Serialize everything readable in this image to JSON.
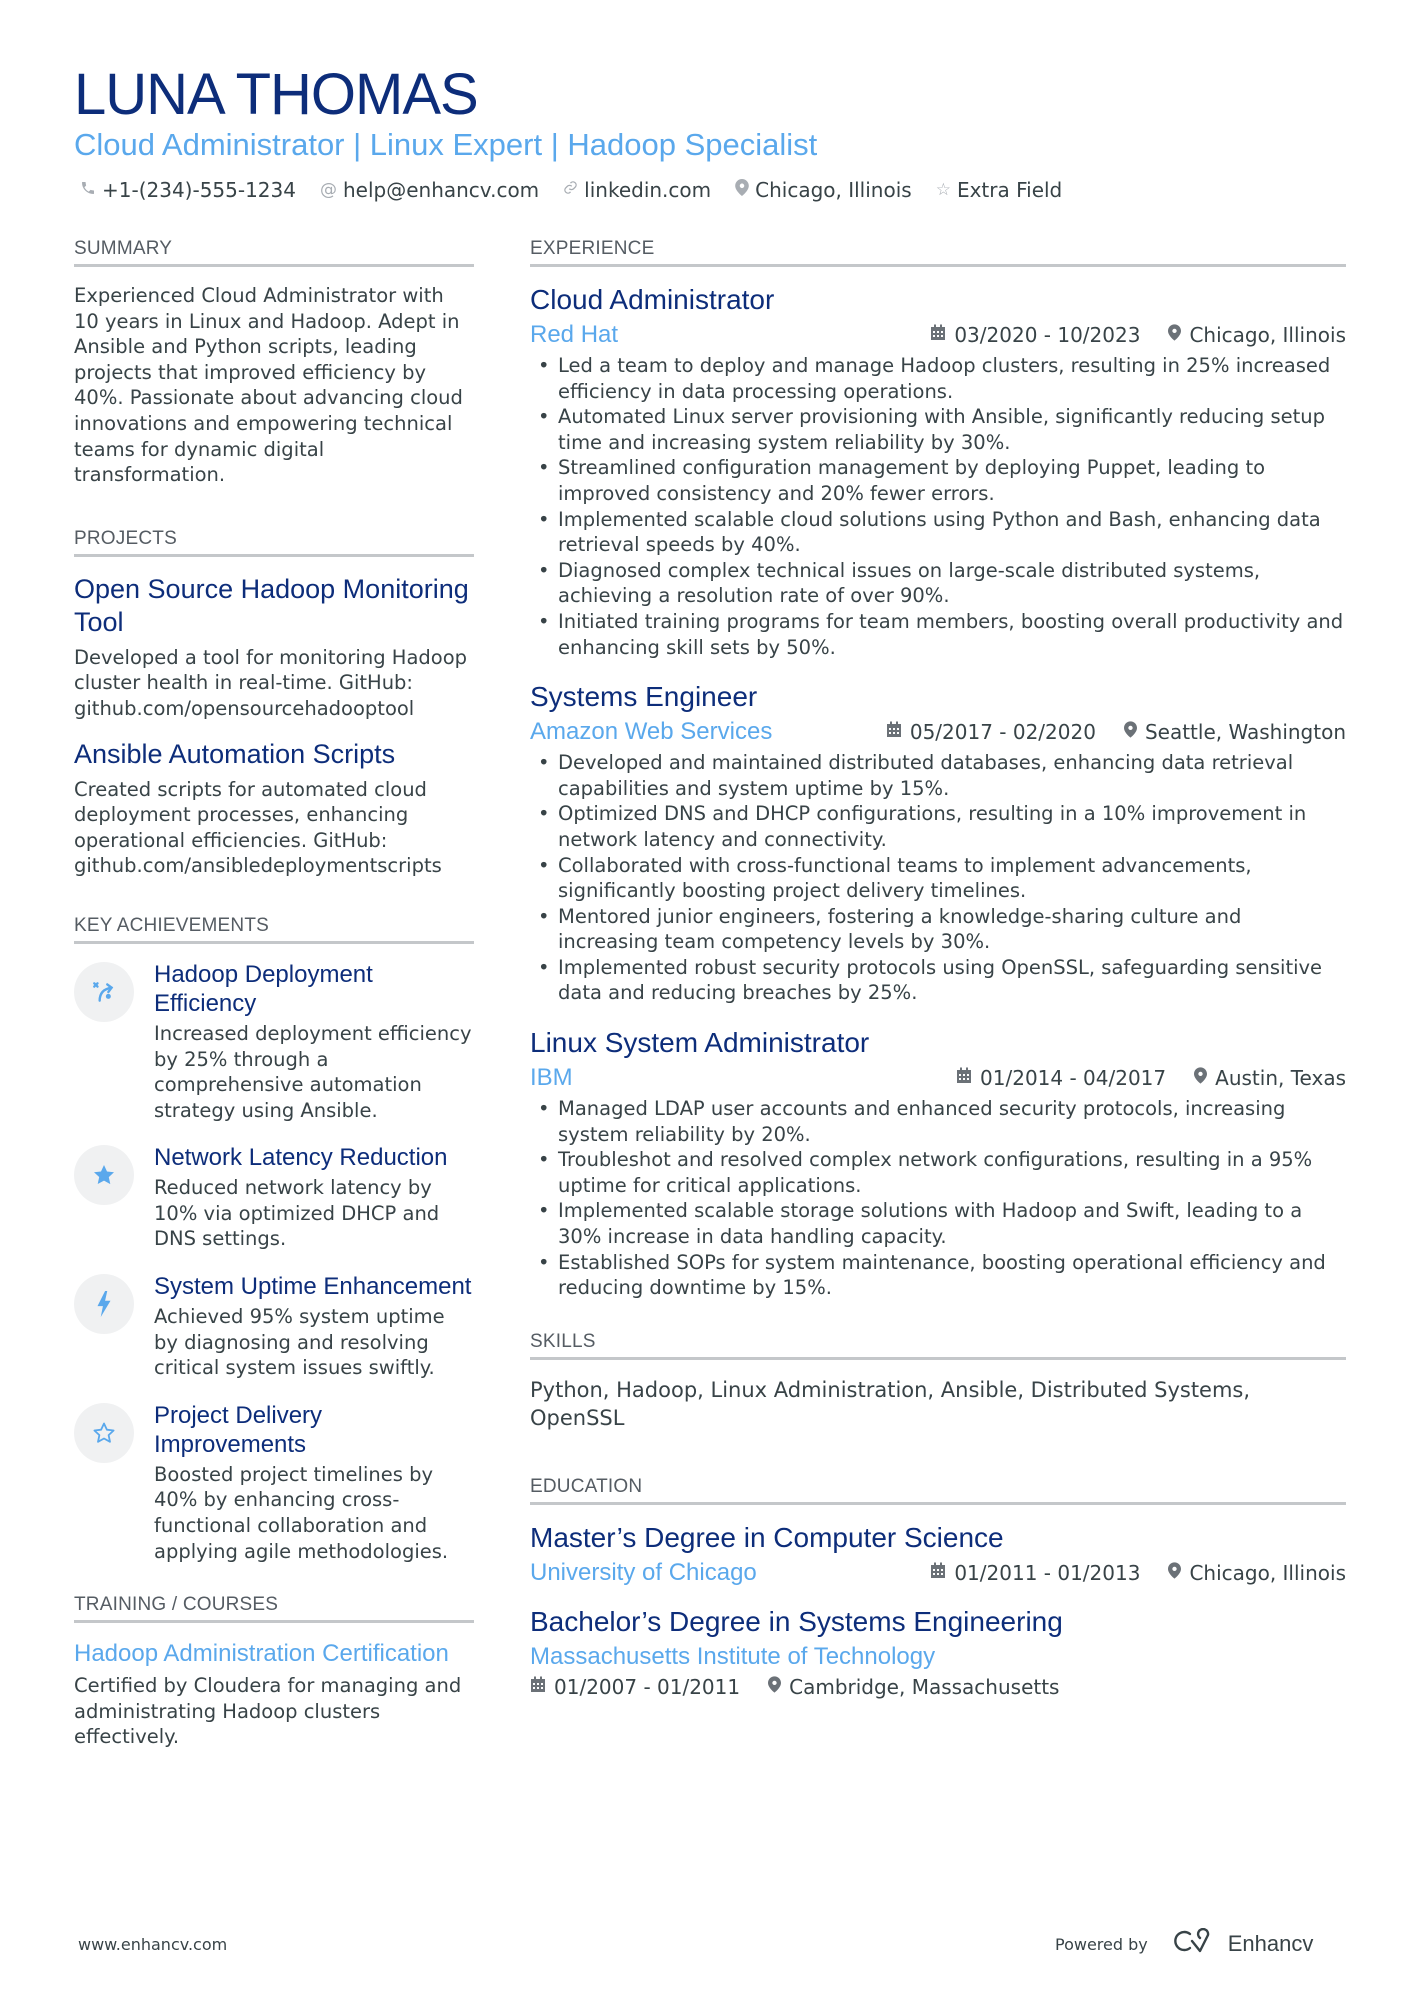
{
  "header": {
    "name": "LUNA THOMAS",
    "headline": "Cloud Administrator | Linux Expert | Hadoop Specialist",
    "contacts": [
      {
        "icon": "phone-icon",
        "glyph": "✆",
        "text": "+1-(234)-555-1234"
      },
      {
        "icon": "at-icon",
        "glyph": "@",
        "text": "help@enhancv.com"
      },
      {
        "icon": "link-icon",
        "glyph": "🔗",
        "text": "linkedin.com"
      },
      {
        "icon": "location-pin-icon",
        "glyph": "⬤",
        "text": "Chicago, Illinois"
      },
      {
        "icon": "star-outline-icon",
        "glyph": "☆",
        "text": "Extra Field"
      }
    ]
  },
  "summary": {
    "title": "SUMMARY",
    "text": "Experienced Cloud Administrator with 10 years in Linux and Hadoop. Adept in Ansible and Python scripts, leading projects that improved efficiency by 40%. Passionate about advancing cloud innovations and empowering technical teams for dynamic digital transformation."
  },
  "projects": {
    "title": "PROJECTS",
    "items": [
      {
        "title": "Open Source Hadoop Monitoring Tool",
        "text": "Developed a tool for monitoring Hadoop cluster health in real-time. GitHub: github.com/opensourcehadooptool"
      },
      {
        "title": "Ansible Automation Scripts",
        "text": "Created scripts for automated cloud deployment processes, enhancing operational efficiencies. GitHub: github.com/ansibledeploymentscripts"
      }
    ]
  },
  "achievements": {
    "title": "KEY ACHIEVEMENTS",
    "items": [
      {
        "icon": "strategy-icon",
        "glyph": "↗",
        "title": "Hadoop Deployment Efficiency",
        "text": "Increased deployment efficiency by 25% through a comprehensive automation strategy using Ansible."
      },
      {
        "icon": "star-filled-icon",
        "glyph": "★",
        "title": "Network Latency Reduction",
        "text": "Reduced network latency by 10% via optimized DHCP and DNS settings."
      },
      {
        "icon": "lightning-icon",
        "glyph": "ϟ",
        "title": "System Uptime Enhancement",
        "text": "Achieved 95% system uptime by diagnosing and resolving critical system issues swiftly."
      },
      {
        "icon": "star-outline-icon",
        "glyph": "☆",
        "title": "Project Delivery Improvements",
        "text": "Boosted project timelines by 40% by enhancing cross-functional collaboration and applying agile methodologies."
      }
    ]
  },
  "training": {
    "title": "TRAINING / COURSES",
    "items": [
      {
        "title": "Hadoop Administration Certification",
        "text": "Certified by Cloudera for managing and administrating Hadoop clusters effectively."
      }
    ]
  },
  "experience": {
    "title": "EXPERIENCE",
    "jobs": [
      {
        "title": "Cloud Administrator",
        "company": "Red Hat",
        "dates": "03/2020 - 10/2023",
        "location": "Chicago, Illinois",
        "bullets": [
          "Led a team to deploy and manage Hadoop clusters, resulting in 25% increased efficiency in data processing operations.",
          "Automated Linux server provisioning with Ansible, significantly reducing setup time and increasing system reliability by 30%.",
          "Streamlined configuration management by deploying Puppet, leading to improved consistency and 20% fewer errors.",
          "Implemented scalable cloud solutions using Python and Bash, enhancing data retrieval speeds by 40%.",
          "Diagnosed complex technical issues on large-scale distributed systems, achieving a resolution rate of over 90%.",
          "Initiated training programs for team members, boosting overall productivity and enhancing skill sets by 50%."
        ]
      },
      {
        "title": "Systems Engineer",
        "company": "Amazon Web Services",
        "dates": "05/2017 - 02/2020",
        "location": "Seattle, Washington",
        "bullets": [
          "Developed and maintained distributed databases, enhancing data retrieval capabilities and system uptime by 15%.",
          "Optimized DNS and DHCP configurations, resulting in a 10% improvement in network latency and connectivity.",
          "Collaborated with cross-functional teams to implement advancements, significantly boosting project delivery timelines.",
          "Mentored junior engineers, fostering a knowledge-sharing culture and increasing team competency levels by 30%.",
          "Implemented robust security protocols using OpenSSL, safeguarding sensitive data and reducing breaches by 25%."
        ]
      },
      {
        "title": "Linux System Administrator",
        "company": "IBM",
        "dates": "01/2014 - 04/2017",
        "location": "Austin, Texas",
        "bullets": [
          "Managed LDAP user accounts and enhanced security protocols, increasing system reliability by 20%.",
          "Troubleshot and resolved complex network configurations, resulting in a 95% uptime for critical applications.",
          "Implemented scalable storage solutions with Hadoop and Swift, leading to a 30% increase in data handling capacity.",
          "Established SOPs for system maintenance, boosting operational efficiency and reducing downtime by 15%."
        ]
      }
    ]
  },
  "skills": {
    "title": "SKILLS",
    "text": "Python, Hadoop, Linux Administration, Ansible, Distributed Systems, OpenSSL"
  },
  "education": {
    "title": "EDUCATION",
    "items": [
      {
        "degree": "Master’s Degree in Computer Science",
        "school": "University of Chicago",
        "dates": "01/2011 - 01/2013",
        "location": "Chicago, Illinois"
      },
      {
        "degree": "Bachelor’s Degree in Systems Engineering",
        "school": "Massachusetts Institute of Technology",
        "dates": "01/2007 - 01/2011",
        "location": "Cambridge, Massachusetts"
      }
    ]
  },
  "footer": {
    "website": "www.enhancv.com",
    "powered_by": "Powered by",
    "brand": "Enhancv"
  },
  "colors": {
    "name": "#0d2d7a",
    "accent": "#5aa8ec",
    "text": "#384347",
    "rule": "#c4c7ca",
    "icon_bg": "#f0f1f2"
  }
}
